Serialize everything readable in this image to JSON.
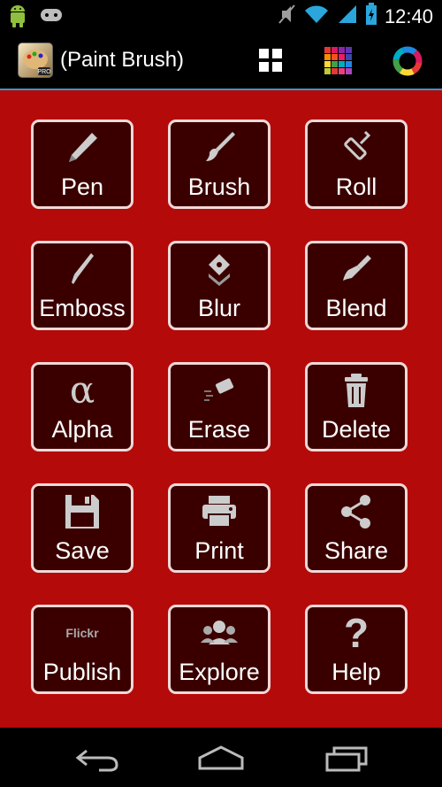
{
  "status_bar": {
    "time": "12:40",
    "left_icons": [
      "android-icon",
      "game-controller-icon"
    ],
    "right_icons": [
      "mute-icon",
      "wifi-icon",
      "signal-icon",
      "battery-icon"
    ]
  },
  "action_bar": {
    "title": "(Paint Brush)",
    "icon_badge": "PRO",
    "actions": [
      "grid-view-icon",
      "color-palette-icon",
      "color-wheel-icon"
    ]
  },
  "tiles": [
    {
      "label": "Pen",
      "icon": "pen-icon"
    },
    {
      "label": "Brush",
      "icon": "brush-icon"
    },
    {
      "label": "Roll",
      "icon": "roller-icon"
    },
    {
      "label": "Emboss",
      "icon": "emboss-icon"
    },
    {
      "label": "Blur",
      "icon": "blur-icon"
    },
    {
      "label": "Blend",
      "icon": "blend-icon"
    },
    {
      "label": "Alpha",
      "icon": "alpha-icon",
      "glyph": "α"
    },
    {
      "label": "Erase",
      "icon": "eraser-icon"
    },
    {
      "label": "Delete",
      "icon": "trash-icon"
    },
    {
      "label": "Save",
      "icon": "save-icon"
    },
    {
      "label": "Print",
      "icon": "printer-icon"
    },
    {
      "label": "Share",
      "icon": "share-icon"
    },
    {
      "label": "Publish",
      "icon": "flickr-icon",
      "glyph": "Flickr"
    },
    {
      "label": "Explore",
      "icon": "people-icon"
    },
    {
      "label": "Help",
      "icon": "question-icon",
      "glyph": "?"
    }
  ],
  "colors": {
    "background": "#b50a0a",
    "tile_fill": "#3a0000",
    "tile_border": "#f1d8d8",
    "accent_line": "#3a97c8"
  },
  "nav_bar": [
    "back-icon",
    "home-icon",
    "recent-apps-icon"
  ]
}
